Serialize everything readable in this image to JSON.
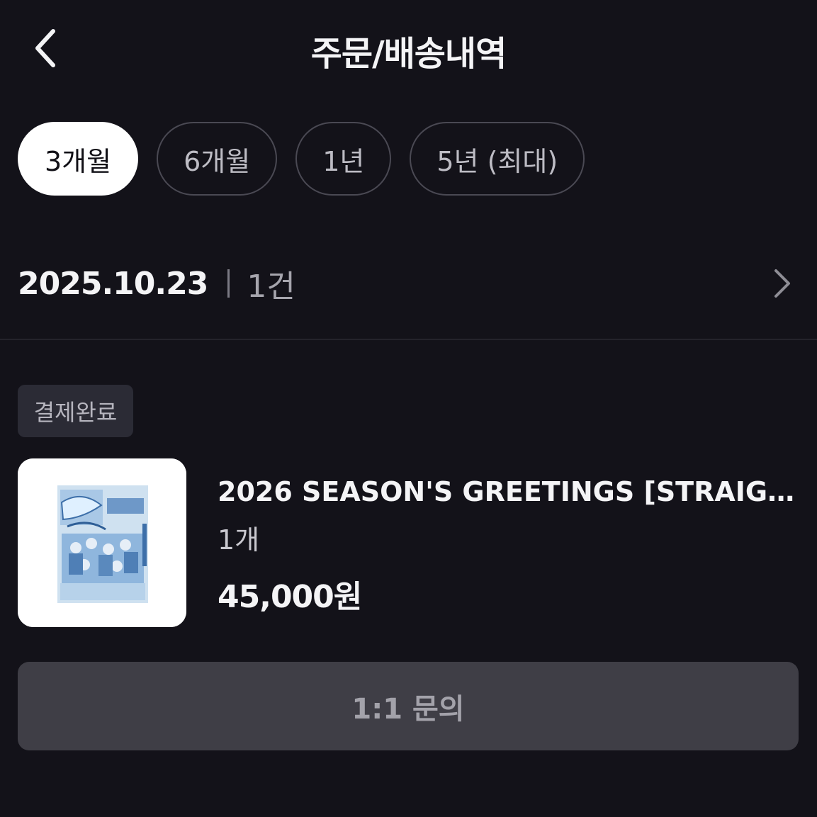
{
  "header": {
    "back_icon": "chevron-left-icon",
    "title": "주문/배송내역"
  },
  "filters": [
    {
      "label": "3개월",
      "active": true
    },
    {
      "label": "6개월",
      "active": false
    },
    {
      "label": "1년",
      "active": false
    },
    {
      "label": "5년 (최대)",
      "active": false
    }
  ],
  "order": {
    "date": "2025.10.23",
    "count": "1건",
    "chevron_icon": "chevron-right-icon",
    "status": "결제완료",
    "product": {
      "name": "2026 SEASON'S GREETINGS [STRAIGHT...",
      "quantity": "1개",
      "price": "45,000원",
      "thumbnail_icon": "product-image"
    }
  },
  "actions": {
    "inquiry_label": "1:1 문의"
  },
  "colors": {
    "background": "#131219",
    "chip_active_bg": "#ffffff",
    "badge_bg": "#2b2b35",
    "button_bg": "#3f3e46"
  }
}
